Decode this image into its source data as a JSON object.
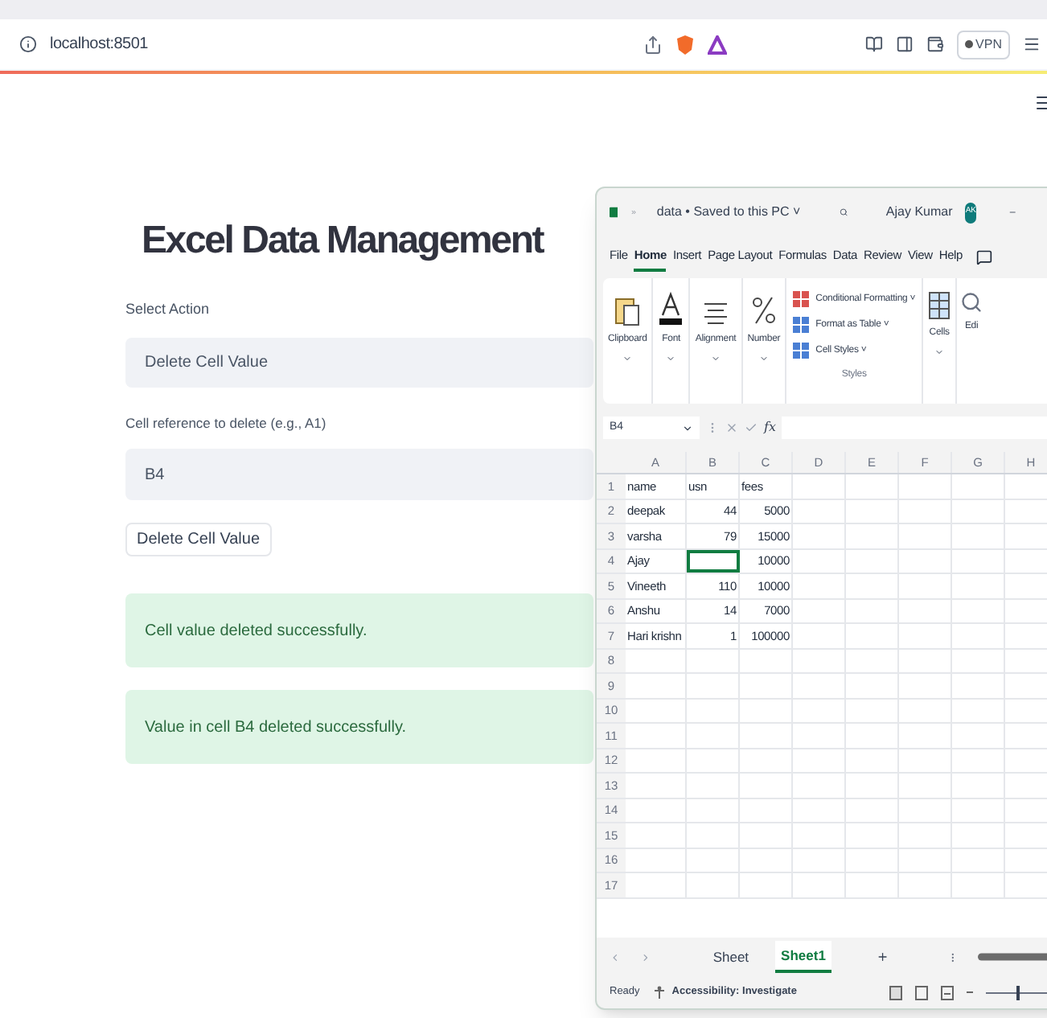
{
  "browser": {
    "url": "localhost:8501",
    "vpn_label": "VPN"
  },
  "app": {
    "title": "Excel Data Management",
    "select_label": "Select Action",
    "select_value": "Delete Cell Value",
    "input_label": "Cell reference to delete (e.g., A1)",
    "input_value": "B4",
    "button_label": "Delete Cell Value",
    "messages": [
      "Cell value deleted successfully.",
      "Value in cell B4 deleted successfully."
    ]
  },
  "excel": {
    "title": "data • Saved to this PC ˅",
    "user": "Ajay Kumar",
    "user_initials": "AK",
    "ribbon_tabs": [
      {
        "label": "File",
        "selected": false
      },
      {
        "label": "Home",
        "selected": true
      },
      {
        "label": "Insert",
        "selected": false
      },
      {
        "label": "Page Layout",
        "selected": false
      },
      {
        "label": "Formulas",
        "selected": false
      },
      {
        "label": "Data",
        "selected": false
      },
      {
        "label": "Review",
        "selected": false
      },
      {
        "label": "View",
        "selected": false
      },
      {
        "label": "Help",
        "selected": false
      }
    ],
    "ribbon_groups": [
      {
        "kind": "clipboard",
        "label": "Clipboard"
      },
      {
        "kind": "font",
        "label": "Font"
      },
      {
        "kind": "alignment",
        "label": "Alignment"
      },
      {
        "kind": "number",
        "label": "Number"
      }
    ],
    "styles_items": [
      "Conditional Formatting ˅",
      "Format as Table ˅",
      "Cell Styles ˅"
    ],
    "styles_label": "Styles",
    "cells_label": "Cells",
    "editing_label": "Edi",
    "name_box": "B4",
    "function_label": "fx",
    "columns": [
      "A",
      "B",
      "C",
      "D",
      "E",
      "F",
      "G",
      "H"
    ],
    "rows": [
      {
        "number": "1",
        "cells": [
          {
            "text": "name",
            "kind": "text",
            "selected": false
          },
          {
            "text": "usn",
            "kind": "text",
            "selected": false
          },
          {
            "text": "fees",
            "kind": "text",
            "selected": false
          }
        ]
      },
      {
        "number": "2",
        "cells": [
          {
            "text": "deepak",
            "kind": "text",
            "selected": false
          },
          {
            "text": "44",
            "kind": "number",
            "selected": false
          },
          {
            "text": "5000",
            "kind": "number",
            "selected": false
          }
        ]
      },
      {
        "number": "3",
        "cells": [
          {
            "text": "varsha",
            "kind": "text",
            "selected": false
          },
          {
            "text": "79",
            "kind": "number",
            "selected": false
          },
          {
            "text": "15000",
            "kind": "number",
            "selected": false
          }
        ]
      },
      {
        "number": "4",
        "cells": [
          {
            "text": "Ajay",
            "kind": "text",
            "selected": false
          },
          {
            "kind": "text",
            "selected": true
          },
          {
            "text": "10000",
            "kind": "number",
            "selected": false
          }
        ]
      },
      {
        "number": "5",
        "cells": [
          {
            "text": "Vineeth",
            "kind": "text",
            "selected": false
          },
          {
            "text": "110",
            "kind": "number",
            "selected": false
          },
          {
            "text": "10000",
            "kind": "number",
            "selected": false
          }
        ]
      },
      {
        "number": "6",
        "cells": [
          {
            "text": "Anshu",
            "kind": "text",
            "selected": false
          },
          {
            "text": "14",
            "kind": "number",
            "selected": false
          },
          {
            "text": "7000",
            "kind": "number",
            "selected": false
          }
        ]
      },
      {
        "number": "7",
        "cells": [
          {
            "text": "Hari krishn",
            "kind": "text",
            "selected": false
          },
          {
            "text": "1",
            "kind": "number",
            "selected": false
          },
          {
            "text": "100000",
            "kind": "number",
            "selected": false
          }
        ]
      },
      {
        "number": "8",
        "cells": []
      },
      {
        "number": "9",
        "cells": []
      },
      {
        "number": "10",
        "cells": []
      },
      {
        "number": "11",
        "cells": []
      },
      {
        "number": "12",
        "cells": []
      },
      {
        "number": "13",
        "cells": []
      },
      {
        "number": "14",
        "cells": []
      },
      {
        "number": "15",
        "cells": []
      },
      {
        "number": "16",
        "cells": []
      },
      {
        "number": "17",
        "cells": []
      }
    ],
    "sheet_tabs": [
      {
        "label": "Sheet",
        "selected": false
      },
      {
        "label": "Sheet1",
        "selected": true
      }
    ],
    "status": {
      "ready": "Ready",
      "accessibility": "Accessibility: Investigate",
      "zoom": {
        "level": 0.5
      }
    }
  }
}
